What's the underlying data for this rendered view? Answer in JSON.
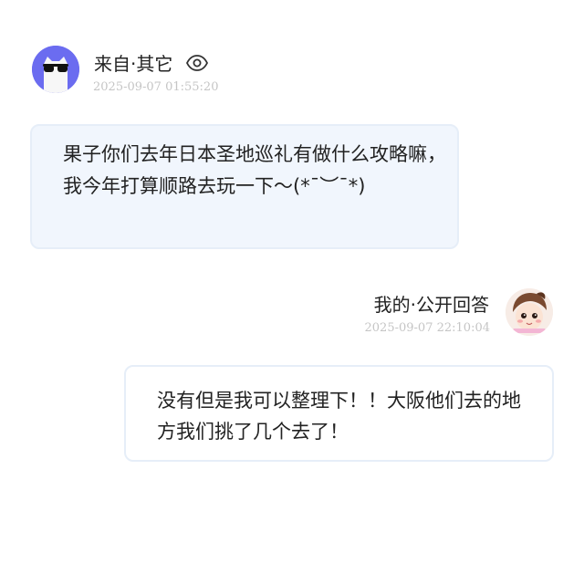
{
  "incoming": {
    "sender_label": "来自·其它",
    "timestamp": "2025-09-07 01:55:20",
    "message": "果子你们去年日本圣地巡礼有做什么攻略嘛，我今年打算顺路去玩一下～(*¯︶¯*)",
    "avatar_icon": "cat-sunglasses-icon",
    "visibility_icon": "eye-icon",
    "accent_color": "#6b6cf0",
    "bubble_color": "#f1f6fd"
  },
  "outgoing": {
    "sender_label": "我的·公开回答",
    "timestamp": "2025-09-07 22:10:04",
    "message": "没有但是我可以整理下！！大阪他们去的地方我们挑了几个去了！",
    "avatar_icon": "cartoon-girl-avatar-icon",
    "bubble_color": "#ffffff",
    "border_color": "#e6eef8"
  }
}
